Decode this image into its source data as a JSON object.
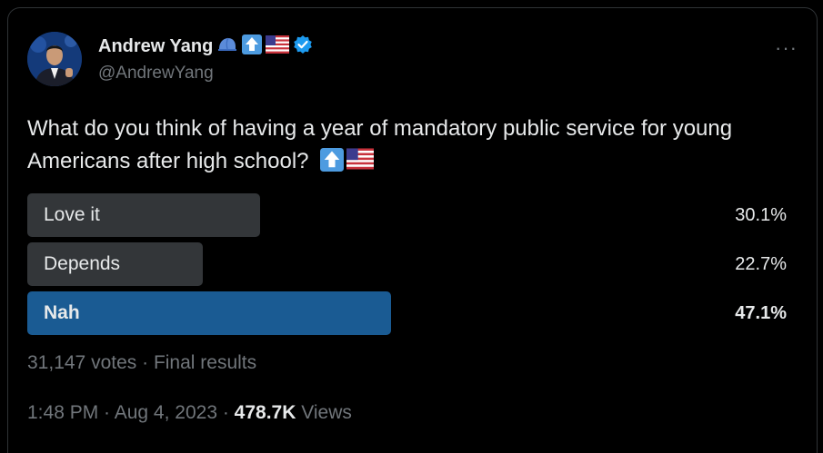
{
  "tweet": {
    "author_name": "Andrew Yang",
    "author_handle": "@AndrewYang",
    "name_emojis": [
      "blue-cap-icon",
      "up-arrow-icon",
      "us-flag-icon",
      "verified-badge-icon"
    ],
    "more_label": "···",
    "question_text": "What do you think of having a year of mandatory public service for young Americans after high school?",
    "question_emojis": [
      "up-arrow-icon",
      "us-flag-icon"
    ]
  },
  "poll": {
    "options": [
      {
        "label": "Love it",
        "percent_text": "30.1%",
        "percent": 30.1,
        "winner": false
      },
      {
        "label": "Depends",
        "percent_text": "22.7%",
        "percent": 22.7,
        "winner": false
      },
      {
        "label": "Nah",
        "percent_text": "47.1%",
        "percent": 47.1,
        "winner": true
      }
    ],
    "votes_text": "31,147 votes",
    "separator": " · ",
    "status_text": "Final results"
  },
  "meta": {
    "time": "1:48 PM",
    "separator": " · ",
    "date": "Aug 4, 2023",
    "views_count": "478.7K",
    "views_label": " Views"
  },
  "colors": {
    "background": "#000000",
    "text_primary": "#e7e9ea",
    "text_secondary": "#71767b",
    "bar_default": "#333639",
    "bar_winner": "#1a5b93",
    "verified": "#1d9bf0"
  }
}
